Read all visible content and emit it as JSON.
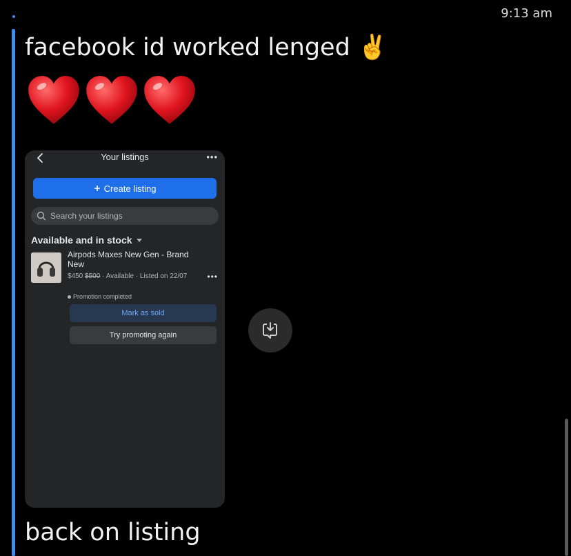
{
  "status": {
    "time": "9:13 am"
  },
  "messages": [
    {
      "text": "facebook id worked lenged ✌️"
    },
    {
      "emoji": "heart",
      "count": 3
    },
    {
      "text": "back on listing"
    }
  ],
  "screenshot": {
    "header_title": "Your listings",
    "more_glyph": "•••",
    "create_button": "Create listing",
    "search_placeholder": "Search your listings",
    "section_title": "Available and in stock",
    "listing": {
      "title": "Airpods Maxes New Gen - Brand New",
      "price": "$450",
      "old_price": "$500",
      "status_text": "· Available · Listed on 22/07",
      "promotion": "Promotion completed",
      "mark_sold": "Mark as sold",
      "promote_again": "Try promoting again"
    }
  },
  "colors": {
    "accent": "#3a8ef0",
    "create_button": "#1f6feb",
    "heart": "#e0141e"
  },
  "icons": [
    "back-arrow-icon",
    "more-icon",
    "plus-icon",
    "search-icon",
    "caret-down-icon",
    "heart-icon",
    "save-image-icon"
  ]
}
